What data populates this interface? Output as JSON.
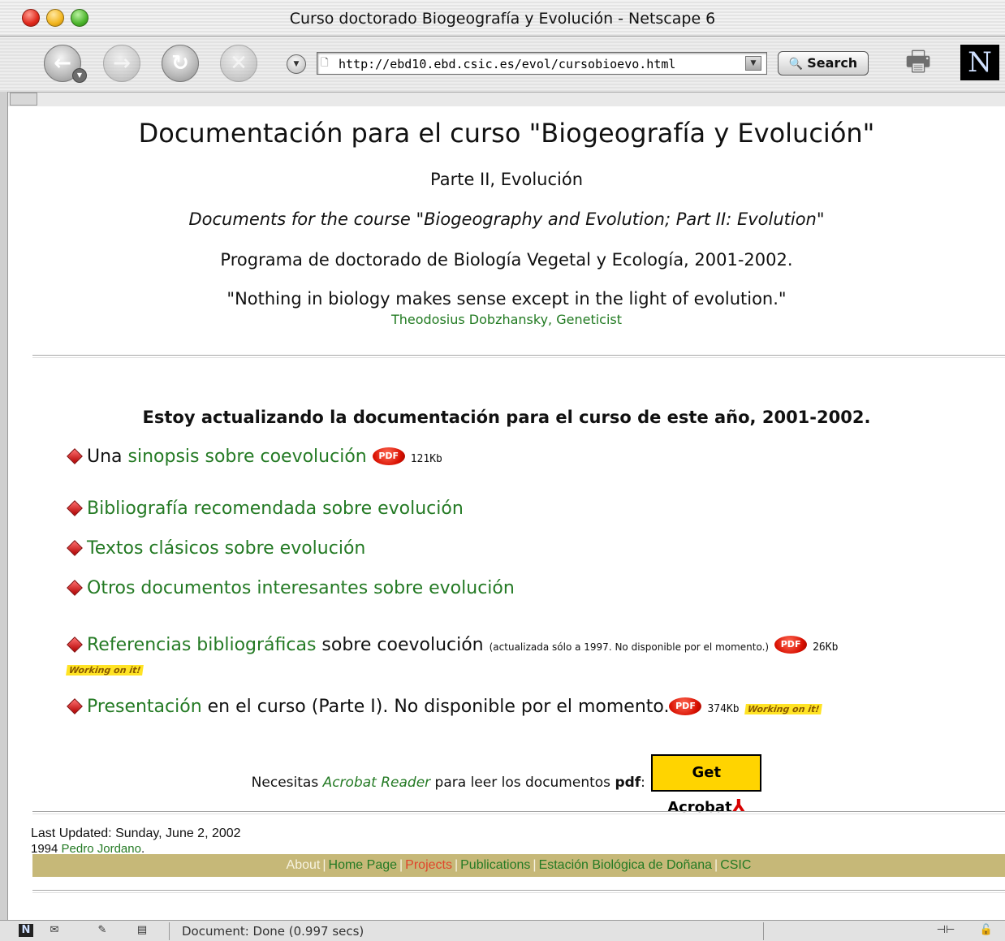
{
  "window": {
    "title": "Curso doctorado Biogeografía y Evolución - Netscape 6"
  },
  "toolbar": {
    "url": "http://ebd10.ebd.csic.es/evol/cursobioevo.html",
    "search_label": "Search",
    "back_glyph": "←",
    "forward_glyph": "→",
    "reload_glyph": "↻",
    "stop_glyph": "✕",
    "logo_letter": "N"
  },
  "page": {
    "title": "Documentación para el curso \"Biogeografía y Evolución\"",
    "part": "Parte II, Evolución",
    "english": "Documents for the course \"Biogeography and Evolution; Part II: Evolution\"",
    "program": "Programa de doctorado de Biología Vegetal y Ecología, 2001-2002.",
    "quote": "\"Nothing in biology makes sense except in the light of evolution.\"",
    "quote_author": "Theodosius Dobzhansky, Geneticist",
    "notice": "Estoy actualizando la documentación para el curso de este año, 2001-2002."
  },
  "items": {
    "item1_pre": "Una ",
    "item1_link": "sinopsis sobre coevolución",
    "item1_size": "121Kb",
    "item2_link": "Bibliografía recomendada sobre evolución",
    "item3_link": "Textos clásicos sobre evolución",
    "item4_link": "Otros documentos interesantes sobre evolución",
    "item5_link": "Referencias bibliográficas",
    "item5_text": " sobre coevolución ",
    "item5_note": "(actualizada sólo a 1997. No disponible por el momento.)",
    "item5_size": "26Kb",
    "item6_link": "Presentación",
    "item6_text": " en el curso (Parte I). No disponible por el momento.",
    "item6_size": "374Kb",
    "pdf_label": "PDF",
    "working_label": "Working on it!"
  },
  "acrobat": {
    "text_pre": "Necesitas ",
    "link": "Acrobat Reader",
    "text_mid": " para leer los documentos ",
    "bold": "pdf",
    "colon": ":",
    "button": "Get Acrobat"
  },
  "footer": {
    "updated": "Last Updated: Sunday, June 2, 2002",
    "year": "1994 ",
    "author": "Pedro Jordano",
    "period": ".",
    "links": {
      "about": "About",
      "home": "Home Page",
      "projects": "Projects",
      "publications": "Publications",
      "estacion": "Estación Biológica de Doñana",
      "csic": "CSIC"
    },
    "separator": "|"
  },
  "status": {
    "text": "Document: Done (0.997 secs)"
  },
  "colors": {
    "link": "#247a24",
    "footer_bar": "#c6b878",
    "pdf_red": "#d80f00",
    "acrobat_yellow": "#ffd400"
  }
}
